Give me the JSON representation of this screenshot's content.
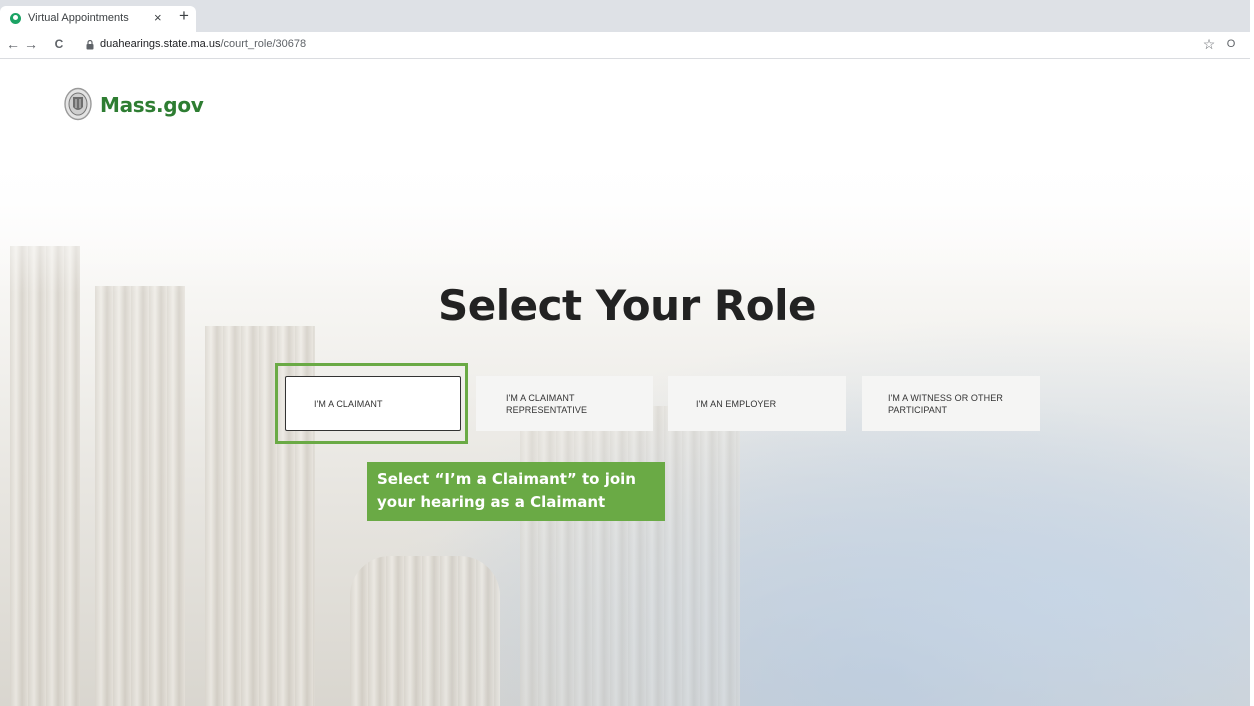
{
  "browser": {
    "tab_title": "Virtual Appointments",
    "close_glyph": "×",
    "new_tab_glyph": "+",
    "back_glyph": "←",
    "forward_glyph": "→",
    "reload_glyph": "C",
    "url_host": "duahearings.state.ma.us",
    "url_path": "/court_role/30678",
    "bookmark_glyph": "☆",
    "extension_glyph": "O"
  },
  "header": {
    "site_name": "Mass.gov"
  },
  "main": {
    "title": "Select Your Role",
    "roles": [
      {
        "line1": "I'M A CLAIMANT",
        "line2": ""
      },
      {
        "line1": "I'M A CLAIMANT",
        "line2": "REPRESENTATIVE"
      },
      {
        "line1": "I'M AN EMPLOYER",
        "line2": ""
      },
      {
        "line1": "I'M A WITNESS OR OTHER",
        "line2": "PARTICIPANT"
      }
    ]
  },
  "annotation": {
    "line1": "Select “I’m a Claimant” to join",
    "line2": "your hearing as a Claimant"
  },
  "colors": {
    "brand_green": "#2e7d32",
    "annotation_green": "#6aaa45"
  }
}
